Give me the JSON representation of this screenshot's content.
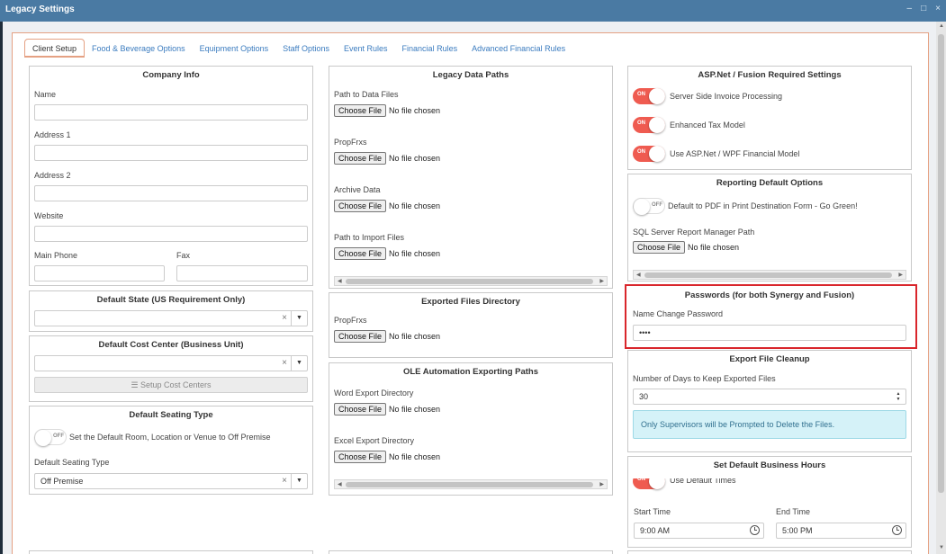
{
  "window": {
    "title": "Legacy Settings",
    "controls": [
      "–",
      "□",
      "×"
    ]
  },
  "tabs": [
    {
      "label": "Client Setup"
    },
    {
      "label": "Food & Beverage Options"
    },
    {
      "label": "Equipment Options"
    },
    {
      "label": "Staff Options"
    },
    {
      "label": "Event Rules"
    },
    {
      "label": "Financial Rules"
    },
    {
      "label": "Advanced Financial Rules"
    }
  ],
  "company_info": {
    "title": "Company Info",
    "name_label": "Name",
    "name_value": "",
    "address1_label": "Address 1",
    "address1_value": "",
    "address2_label": "Address 2",
    "address2_value": "",
    "website_label": "Website",
    "website_value": "",
    "main_phone_label": "Main Phone",
    "main_phone_value": "",
    "fax_label": "Fax",
    "fax_value": ""
  },
  "default_state": {
    "title": "Default State (US Requirement Only)",
    "value": ""
  },
  "default_cost_center": {
    "title": "Default Cost Center (Business Unit)",
    "value": "",
    "setup_button": "Setup Cost Centers"
  },
  "default_seating": {
    "title": "Default Seating Type",
    "toggle_state": "OFF",
    "toggle_label": "Set the Default Room, Location or Venue to Off Premise",
    "type_label": "Default Seating Type",
    "type_value": "Off Premise"
  },
  "legacy_paths": {
    "title": "Legacy Data Paths",
    "items": [
      {
        "label": "Path to Data Files",
        "button": "Choose File",
        "status": "No file chosen"
      },
      {
        "label": "PropFrxs",
        "button": "Choose File",
        "status": "No file chosen"
      },
      {
        "label": "Archive Data",
        "button": "Choose File",
        "status": "No file chosen"
      },
      {
        "label": "Path to Import Files",
        "button": "Choose File",
        "status": "No file chosen"
      }
    ]
  },
  "exported_files": {
    "title": "Exported Files Directory",
    "label": "PropFrxs",
    "button": "Choose File",
    "status": "No file chosen"
  },
  "ole_paths": {
    "title": "OLE Automation Exporting Paths",
    "items": [
      {
        "label": "Word Export Directory",
        "button": "Choose File",
        "status": "No file chosen"
      },
      {
        "label": "Excel Export Directory",
        "button": "Choose File",
        "status": "No file chosen"
      }
    ]
  },
  "aspnet": {
    "title": "ASP.Net / Fusion Required Settings",
    "items": [
      {
        "state": "ON",
        "label": "Server Side Invoice Processing"
      },
      {
        "state": "ON",
        "label": "Enhanced Tax Model"
      },
      {
        "state": "ON",
        "label": "Use ASP.Net / WPF Financial Model"
      }
    ]
  },
  "reporting": {
    "title": "Reporting Default Options",
    "toggle_state": "OFF",
    "toggle_label": "Default to PDF in Print Destination Form - Go Green!",
    "ssrs_label": "SQL Server Report Manager Path",
    "button": "Choose File",
    "status": "No file chosen"
  },
  "passwords": {
    "title": "Passwords (for both Synergy and Fusion)",
    "label": "Name Change Password",
    "value": "••••"
  },
  "export_cleanup": {
    "title": "Export File Cleanup",
    "days_label": "Number of Days to Keep Exported Files",
    "days_value": "30",
    "info": "Only Supervisors will be Prompted to Delete the Files."
  },
  "business_hours": {
    "title": "Set Default Business Hours",
    "toggle_state": "ON",
    "toggle_label": "Use Default Times",
    "start_label": "Start Time",
    "start_value": "9:00 AM",
    "end_label": "End Time",
    "end_value": "5:00 PM"
  },
  "colors": {
    "titlebar": "#4a7aa3",
    "accent": "#ef5b50",
    "tab_border": "#e5a183",
    "highlight": "#d9262c",
    "link": "#3a7bbf"
  }
}
